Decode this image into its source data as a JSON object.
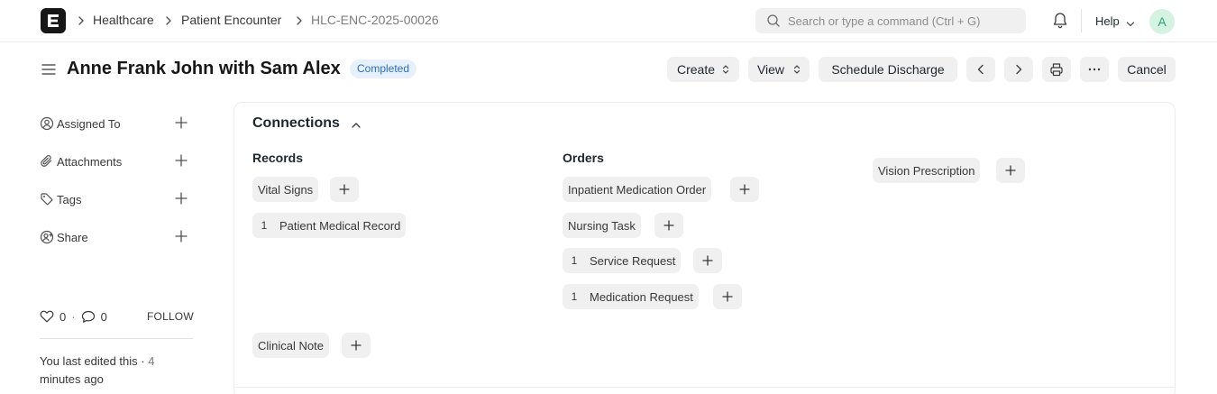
{
  "breadcrumbs": [
    "Healthcare",
    "Patient Encounter",
    "HLC-ENC-2025-00026"
  ],
  "search": {
    "placeholder": "Search or type a command (Ctrl + G)"
  },
  "navbar": {
    "help_label": "Help",
    "avatar_initial": "A",
    "logo_letter": "E"
  },
  "page": {
    "title": "Anne Frank John with Sam Alex",
    "status": "Completed"
  },
  "actions": {
    "create": "Create",
    "view": "View",
    "schedule_discharge": "Schedule Discharge",
    "cancel": "Cancel"
  },
  "sidebar": {
    "items": [
      {
        "label": "Assigned To",
        "icon": "assign-icon"
      },
      {
        "label": "Attachments",
        "icon": "paperclip-icon"
      },
      {
        "label": "Tags",
        "icon": "tag-icon"
      },
      {
        "label": "Share",
        "icon": "share-icon"
      }
    ],
    "likes": "0",
    "comments": "0",
    "follow": "FOLLOW",
    "edited_prefix": "You last edited this · ",
    "edited_time": "4",
    "edited_suffix": "minutes ago"
  },
  "connections": {
    "title": "Connections",
    "records": {
      "title": "Records",
      "items": [
        {
          "label": "Vital Signs",
          "count": ""
        },
        {
          "label": "Patient Medical Record",
          "count": "1"
        },
        {
          "label": "Clinical Note",
          "count": ""
        }
      ]
    },
    "orders": {
      "title": "Orders",
      "items": [
        {
          "label": "Inpatient Medication Order",
          "count": ""
        },
        {
          "label": "Nursing Task",
          "count": ""
        },
        {
          "label": "Service Request",
          "count": "1"
        },
        {
          "label": "Medication Request",
          "count": "1"
        }
      ]
    },
    "other": {
      "items": [
        {
          "label": "Vision Prescription",
          "count": ""
        }
      ]
    }
  },
  "colors": {
    "status_bg": "#e6f1fd",
    "status_text": "#2d6cc4",
    "avatar_bg": "#d5f3e1",
    "avatar_text": "#30a66d",
    "button_bg": "#f0f0f0"
  }
}
